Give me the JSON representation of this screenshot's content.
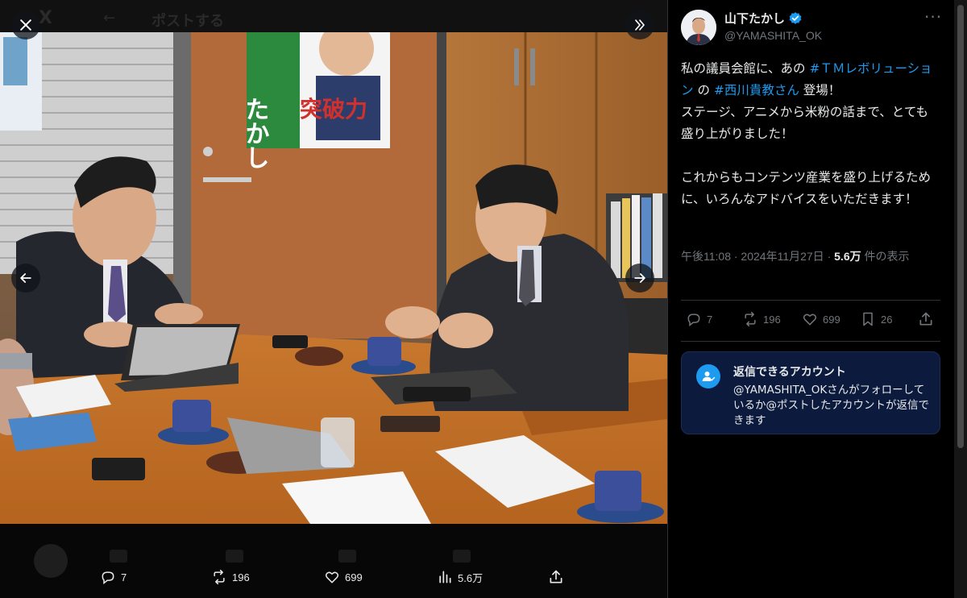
{
  "background_header": {
    "logo": "x-logo-icon",
    "back_icon": "arrow-left-icon",
    "title": "ポストする"
  },
  "viewer": {
    "close_icon": "close-icon",
    "collapse_icon": "chevron-double-right-icon",
    "prev_icon": "arrow-left-icon",
    "next_icon": "arrow-right-icon",
    "photo_text": {
      "poster_left": "たかし",
      "poster_slogan": "突破力"
    },
    "actions": {
      "replies": "7",
      "reposts": "196",
      "likes": "699",
      "views": "5.6万"
    }
  },
  "panel": {
    "display_name": "山下たかし",
    "handle": "@YAMASHITA_OK",
    "text_segments": [
      {
        "t": "私の議員会館に、あの "
      },
      {
        "t": "#ＴＭレボリューション",
        "tag": true
      },
      {
        "t": " の "
      },
      {
        "t": "#西川貴教さん",
        "tag": true
      },
      {
        "t": " 登場！\nステージ、アニメから米粉の話まで、とても盛り上がりました！\n\nこれからもコンテンツ産業を盛り上げるために、いろんなアドバイスをいただきます！"
      }
    ],
    "meta": {
      "time": "午後11:08 · 2024年11月27日 · ",
      "views": "5.6万",
      "views_suffix": " 件の表示"
    },
    "actions": {
      "replies": "7",
      "reposts": "196",
      "likes": "699",
      "bookmarks": "26"
    },
    "reply_card": {
      "title": "返信できるアカウント",
      "body": "@YAMASHITA_OKさんがフォローしているか@ポストしたアカウントが返信できます"
    }
  },
  "colors": {
    "accent": "#1d9bf0",
    "text_primary": "#e7e9ea",
    "text_secondary": "#71767b",
    "reply_card_bg": "#0b1a3d"
  }
}
